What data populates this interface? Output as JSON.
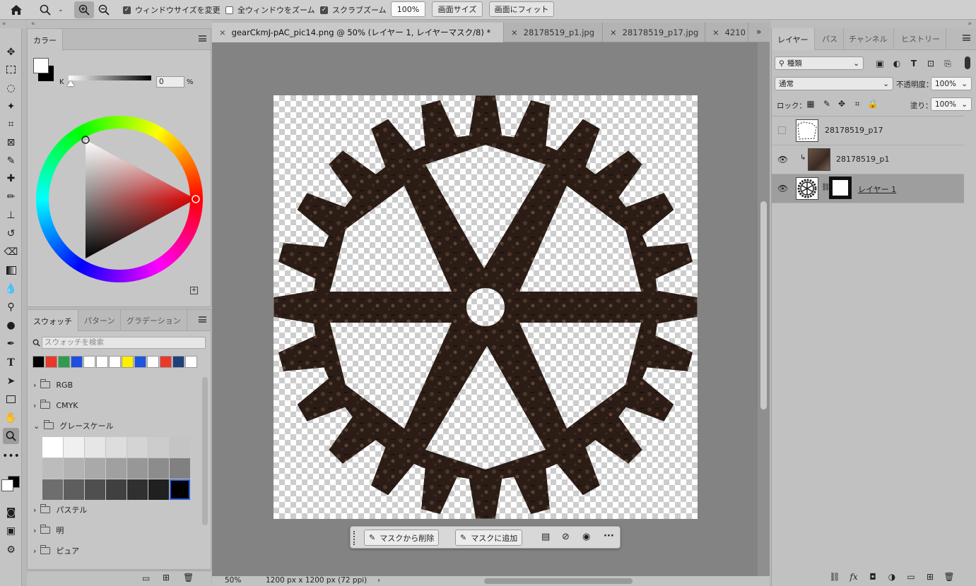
{
  "options_bar": {
    "resize_windows_label": "ウィンドウサイズを変更",
    "zoom_all_label": "全ウィンドウをズーム",
    "scrubby_label": "スクラブズーム",
    "zoom_value": "100%",
    "fit_screen_label": "画面サイズ",
    "fill_screen_label": "画面にフィット"
  },
  "color_panel": {
    "tab": "カラー",
    "k_label": "K",
    "k_value": "0",
    "percent": "%"
  },
  "swatch_panel": {
    "tabs": [
      "スウォッチ",
      "パターン",
      "グラデーション"
    ],
    "search_placeholder": "スウォッチを検索",
    "recent_colors": [
      "#000000",
      "#e8392a",
      "#2e9b4f",
      "#1f4fe0",
      "#ffffff",
      "#ffffff",
      "#ffffff",
      "#ffef00",
      "#1f55e0",
      "#ffffff",
      "#e8392a",
      "#20407a",
      "#ffffff"
    ],
    "groups": [
      {
        "name": "RGB",
        "open": false
      },
      {
        "name": "CMYK",
        "open": false
      },
      {
        "name": "グレースケール",
        "open": true
      },
      {
        "name": "パステル",
        "open": false
      },
      {
        "name": "明",
        "open": false
      },
      {
        "name": "ピュア",
        "open": false
      }
    ],
    "grays": [
      "#ffffff",
      "#f0f0f0",
      "#e6e6e6",
      "#dddddd",
      "#d4d4d4",
      "#cccccc",
      "#c4c4c4",
      "#bcbcbc",
      "#b3b3b3",
      "#a9a9a9",
      "#a0a0a0",
      "#979797",
      "#8c8c8c",
      "#808080",
      "#6e6e6e",
      "#5e5e5e",
      "#4f4f4f",
      "#404040",
      "#303030",
      "#202020",
      "#000000"
    ]
  },
  "document": {
    "tabs": [
      {
        "label": "gearCkmJ-pAC_pic14.png @ 50% (レイヤー 1, レイヤーマスク/8) *",
        "active": true
      },
      {
        "label": "28178519_p1.jpg",
        "active": false
      },
      {
        "label": "28178519_p17.jpg",
        "active": false
      },
      {
        "label": "4210",
        "active": false
      }
    ],
    "zoom": "50%",
    "info": "1200 px x 1200 px (72 ppi)"
  },
  "taskbar": {
    "remove_label": "マスクから削除",
    "add_label": "マスクに追加"
  },
  "layers_panel": {
    "tabs": [
      "レイヤー",
      "パス",
      "チャンネル",
      "ヒストリー"
    ],
    "filter_label": "種類",
    "blend_mode": "通常",
    "opacity_label": "不透明度：",
    "opacity_value": "100%",
    "lock_label": "ロック：",
    "fill_label": "塗り：",
    "fill_value": "100%",
    "layers": [
      {
        "name": "28178519_p17",
        "visible": false,
        "selected": false
      },
      {
        "name": "28178519_p1",
        "visible": true,
        "selected": false
      },
      {
        "name": "レイヤー 1",
        "visible": true,
        "selected": true
      }
    ]
  }
}
